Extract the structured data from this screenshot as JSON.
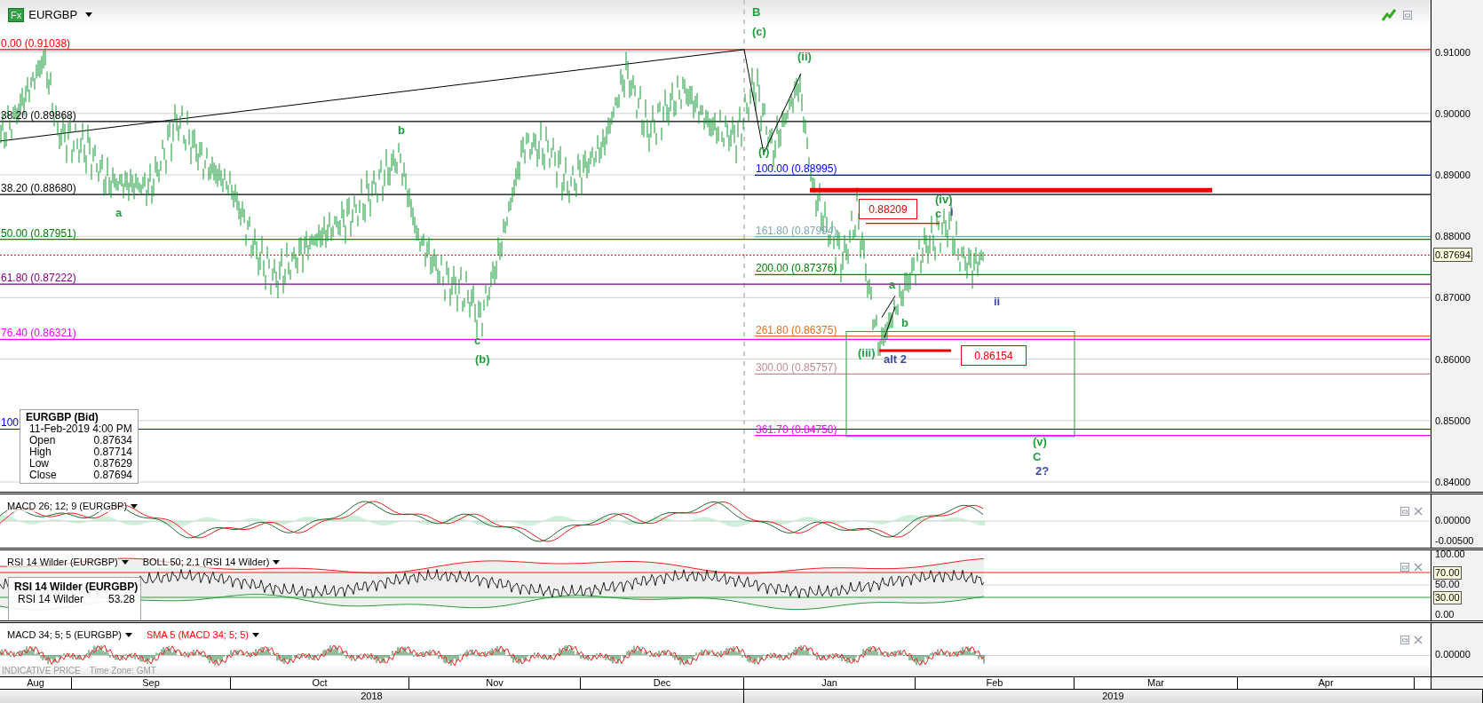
{
  "instrument": {
    "logo_text": "Fx",
    "symbol": "EURGBP"
  },
  "fib_levels_left": [
    {
      "label": "0.00 (0.91038)",
      "color": "#ff0000"
    },
    {
      "label": "38.20 (0.89868)",
      "color": "#000000"
    },
    {
      "label": "38.20 (0.88680)",
      "color": "#000000"
    },
    {
      "label": "50.00 (0.87951)",
      "color": "#008000"
    },
    {
      "label": "61.80 (0.87222)",
      "color": "#800080"
    },
    {
      "label": "76.40 (0.86321)",
      "color": "#ff00ff"
    },
    {
      "label": "100",
      "color": "#0000ff"
    }
  ],
  "fib_levels_right": [
    {
      "label": "100.00 (0.88995)",
      "color": "#0000ff"
    },
    {
      "label": "161.80 (0.87994)",
      "color": "#7fa7b0"
    },
    {
      "label": "200.00 (0.87376)",
      "color": "#008000"
    },
    {
      "label": "261.80 (0.86375)",
      "color": "#e07020"
    },
    {
      "label": "300.00 (0.85757)",
      "color": "#bc8f8f"
    },
    {
      "label": "361.70 (0.84758)",
      "color": "#ff00ff"
    }
  ],
  "wave_labels": [
    {
      "text": "B",
      "color": "#1f9e3f"
    },
    {
      "text": "(c)",
      "color": "#1f9e3f"
    },
    {
      "text": "(ii)",
      "color": "#1f9e3f"
    },
    {
      "text": "(i)",
      "color": "#1f9e3f"
    },
    {
      "text": "a",
      "color": "#1f9e3f"
    },
    {
      "text": "b",
      "color": "#1f9e3f"
    },
    {
      "text": "c",
      "color": "#1f9e3f"
    },
    {
      "text": "(b)",
      "color": "#1f9e3f"
    },
    {
      "text": "(iv)",
      "color": "#1f9e3f"
    },
    {
      "text": "c",
      "color": "#1f9e3f"
    },
    {
      "text": "i",
      "color": "#3b4aa0"
    },
    {
      "text": "a",
      "color": "#1f9e3f"
    },
    {
      "text": "b",
      "color": "#1f9e3f"
    },
    {
      "text": "(iii)",
      "color": "#1f9e3f"
    },
    {
      "text": "alt 2",
      "color": "#3b4aa0"
    },
    {
      "text": "ii",
      "color": "#3b4aa0"
    },
    {
      "text": "(v)",
      "color": "#1f9e3f"
    },
    {
      "text": "C",
      "color": "#1f9e3f"
    },
    {
      "text": "2?",
      "color": "#3b4aa0"
    }
  ],
  "price_boxes": [
    "0.88209",
    "0.86154"
  ],
  "ohlc_tooltip": {
    "title": "EURGBP (Bid)",
    "datetime": "11-Feb-2019 4:00 PM",
    "rows": [
      {
        "label": "Open",
        "value": "0.87634"
      },
      {
        "label": "High",
        "value": "0.87714"
      },
      {
        "label": "Low",
        "value": "0.87629"
      },
      {
        "label": "Close",
        "value": "0.87694"
      }
    ]
  },
  "price_axis": {
    "ticks": [
      "0.91000",
      "0.90000",
      "0.89000",
      "0.88000",
      "0.87000",
      "0.86000",
      "0.85000",
      "0.84000"
    ],
    "last_price": "0.87694"
  },
  "macd_panel": {
    "legends": [
      {
        "text": "MACD 26; 12; 9 (EURGBP)",
        "color": "#000000"
      }
    ],
    "ticks": [
      "0.00000",
      "-0.00500"
    ]
  },
  "rsi_panel": {
    "legends": [
      {
        "text": "RSI 14 Wilder (EURGBP)",
        "color": "#000000"
      },
      {
        "text": "BOLL 50; 2.1 (RSI 14 Wilder)",
        "color": "#000000"
      }
    ],
    "tooltip": {
      "title": "RSI 14 Wilder (EURGBP)",
      "label": "RSI 14 Wilder",
      "value": "53.28"
    },
    "ticks": [
      {
        "label": "100.00",
        "kind": "tick"
      },
      {
        "label": "70.00",
        "kind": "marker"
      },
      {
        "label": "50.00",
        "kind": "tick"
      },
      {
        "label": "30.00",
        "kind": "marker"
      },
      {
        "label": "0.00",
        "kind": "tick"
      }
    ]
  },
  "macd2_panel": {
    "legends": [
      {
        "text": "MACD 34; 5; 5 (EURGBP)",
        "color": "#000000"
      },
      {
        "text": "SMA 5 (MACD 34; 5; 5)",
        "color": "#ff0000"
      }
    ],
    "ticks": [
      "0.00000"
    ]
  },
  "footer": {
    "source": "INDICATIVE PRICE",
    "timezone": "Time Zone: GMT"
  },
  "months": [
    "Aug",
    "Sep",
    "Oct",
    "Nov",
    "Dec",
    "Jan",
    "Feb",
    "Mar",
    "Apr"
  ],
  "years": [
    "2018",
    "2019"
  ]
}
